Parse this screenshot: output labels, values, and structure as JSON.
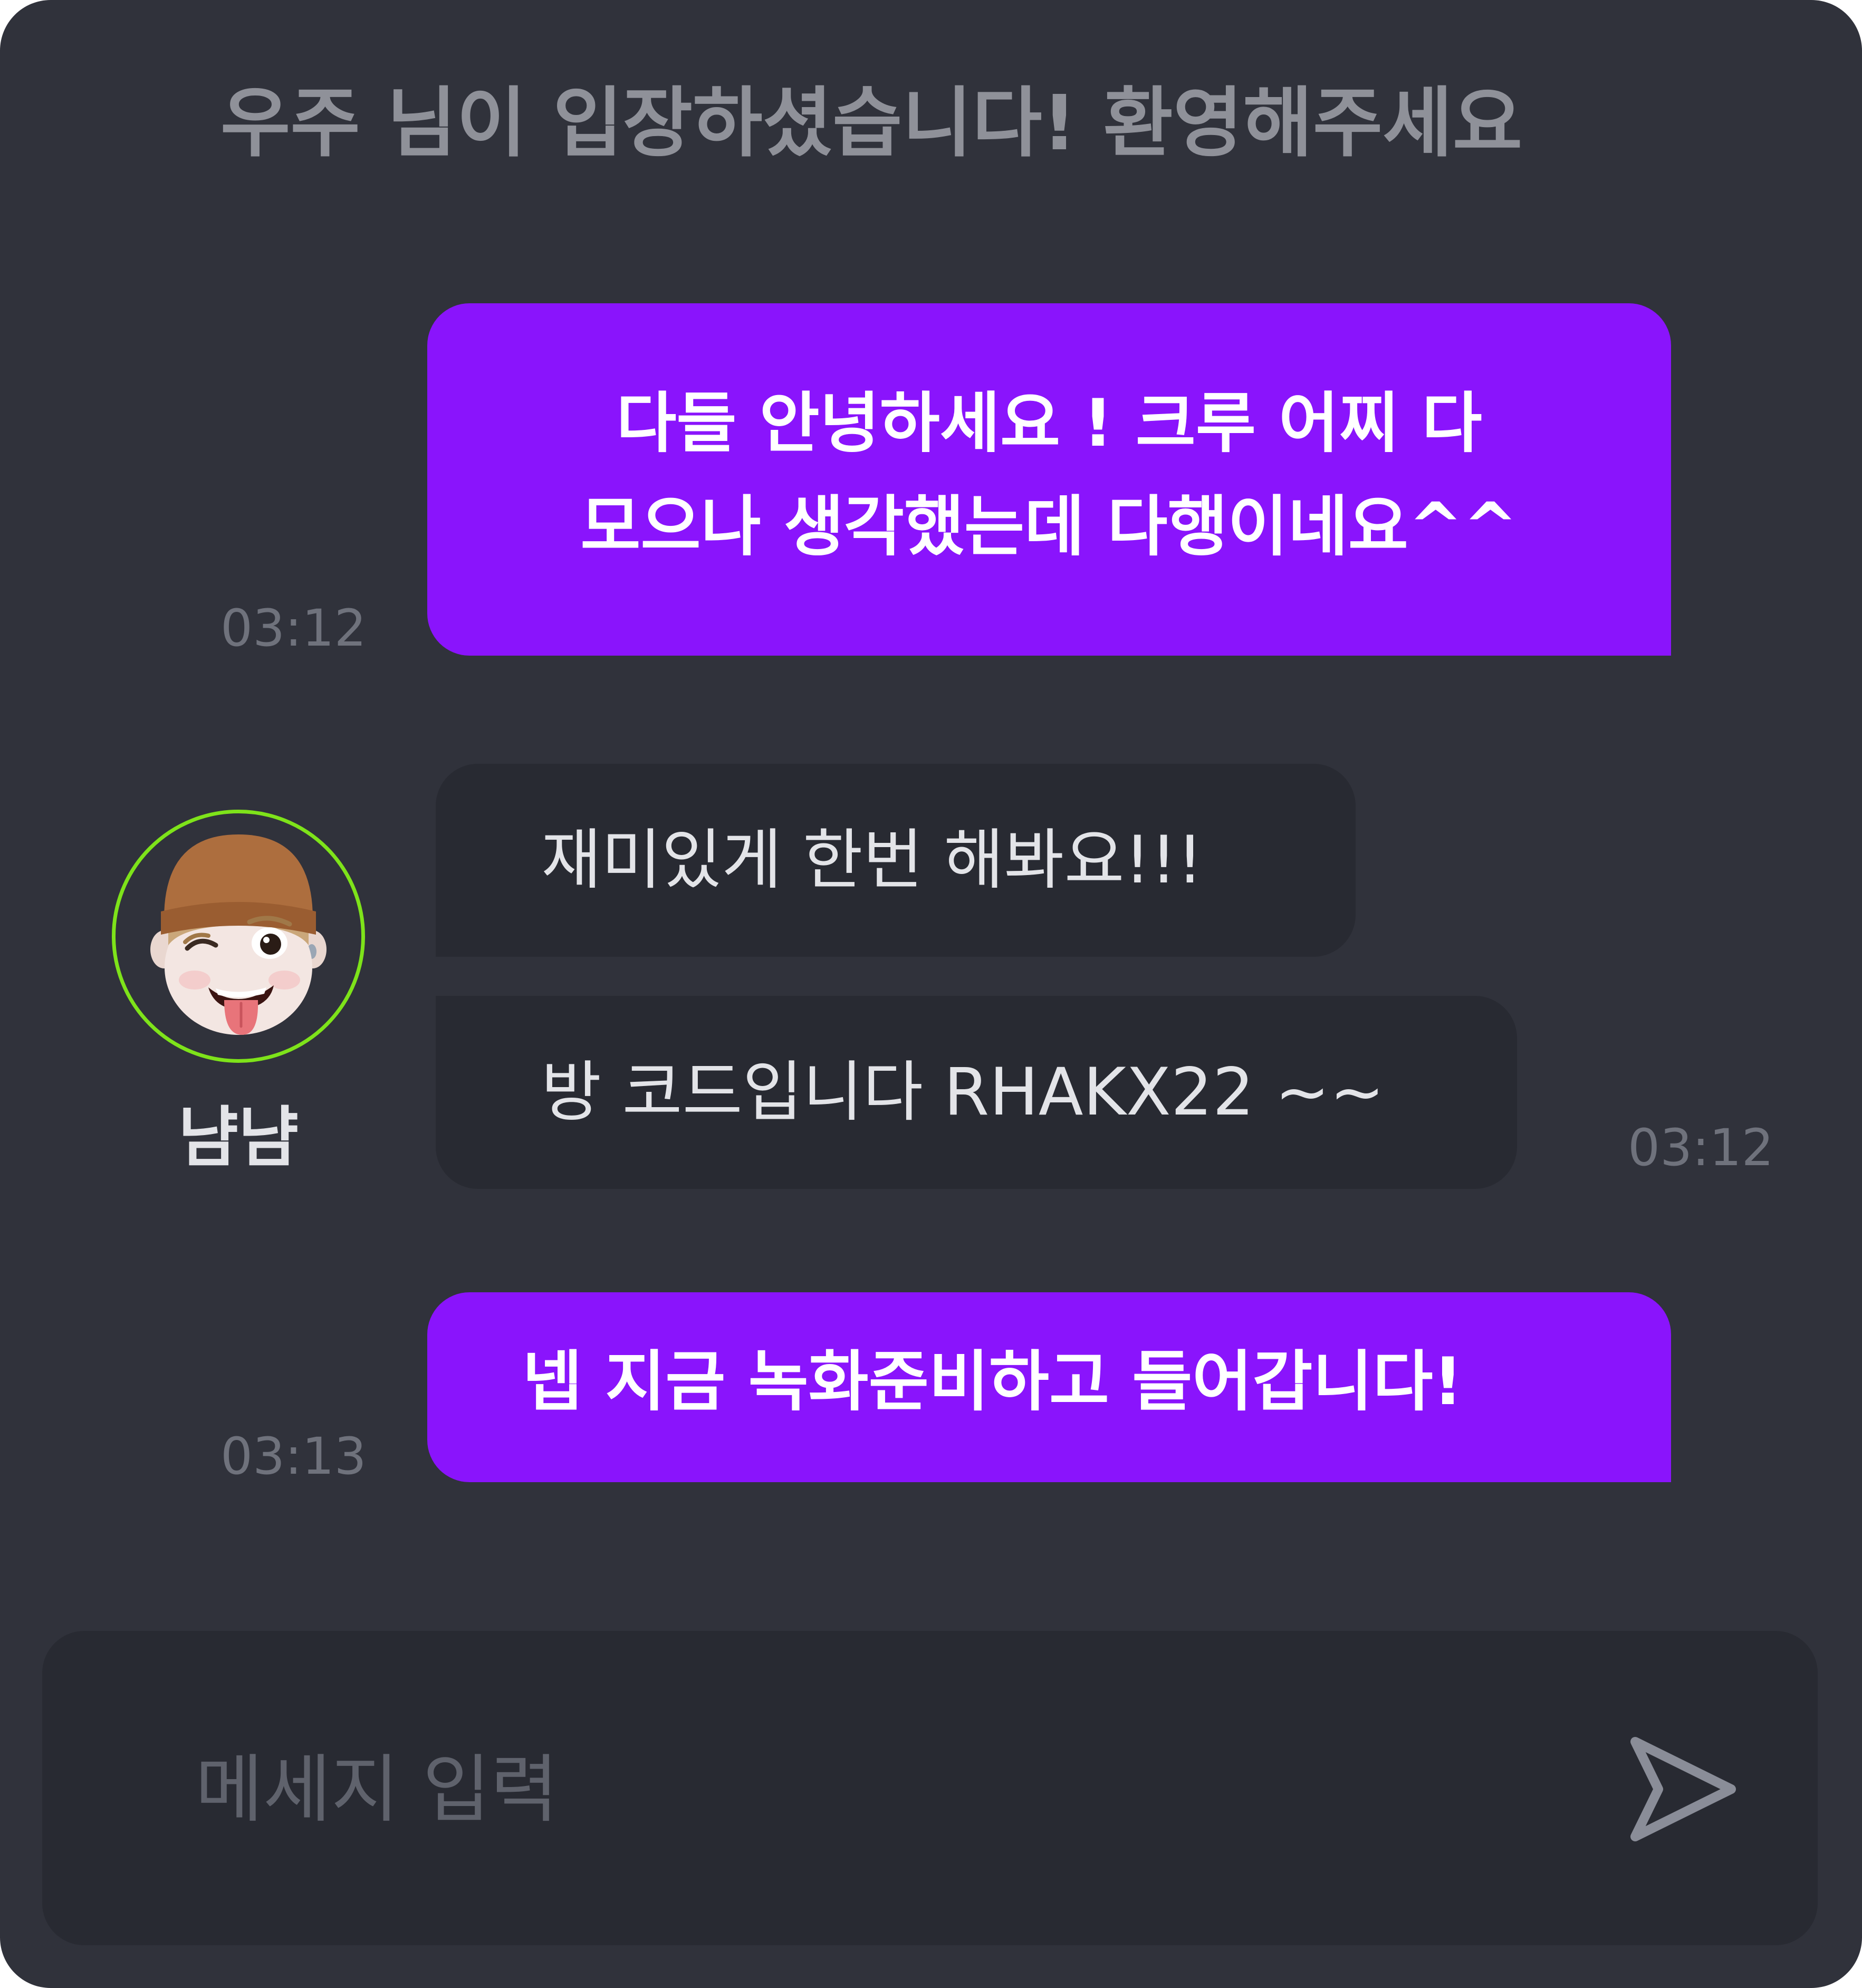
{
  "system_notice": "우주 님이 입장하셨습니다! 환영해주세요",
  "messages": [
    {
      "author": "me",
      "text": "다들 안녕하세요 ! 크루 어찌 다\n모으나 생각했는데 다행이네요^^",
      "time": "03:12"
    },
    {
      "author": "냠냠",
      "text": "재미있게 한번 해봐요!!!"
    },
    {
      "author": "냠냠",
      "text": "방 코드입니다 RHAKX22 ~~",
      "time": "03:12"
    },
    {
      "author": "me",
      "text": "넵 지금 녹화준비하고 들어갑니다!",
      "time": "03:13"
    }
  ],
  "participant": {
    "name": "냠냠",
    "avatar_icon": "memoji-avatar-icon",
    "ring_color": "#7ee31a"
  },
  "composer": {
    "placeholder": "메세지 입력",
    "send_icon": "send-icon"
  },
  "colors": {
    "background": "#30323b",
    "my_bubble": "#8a14fc",
    "their_bubble": "#282a32",
    "timestamp": "#6f727c"
  }
}
